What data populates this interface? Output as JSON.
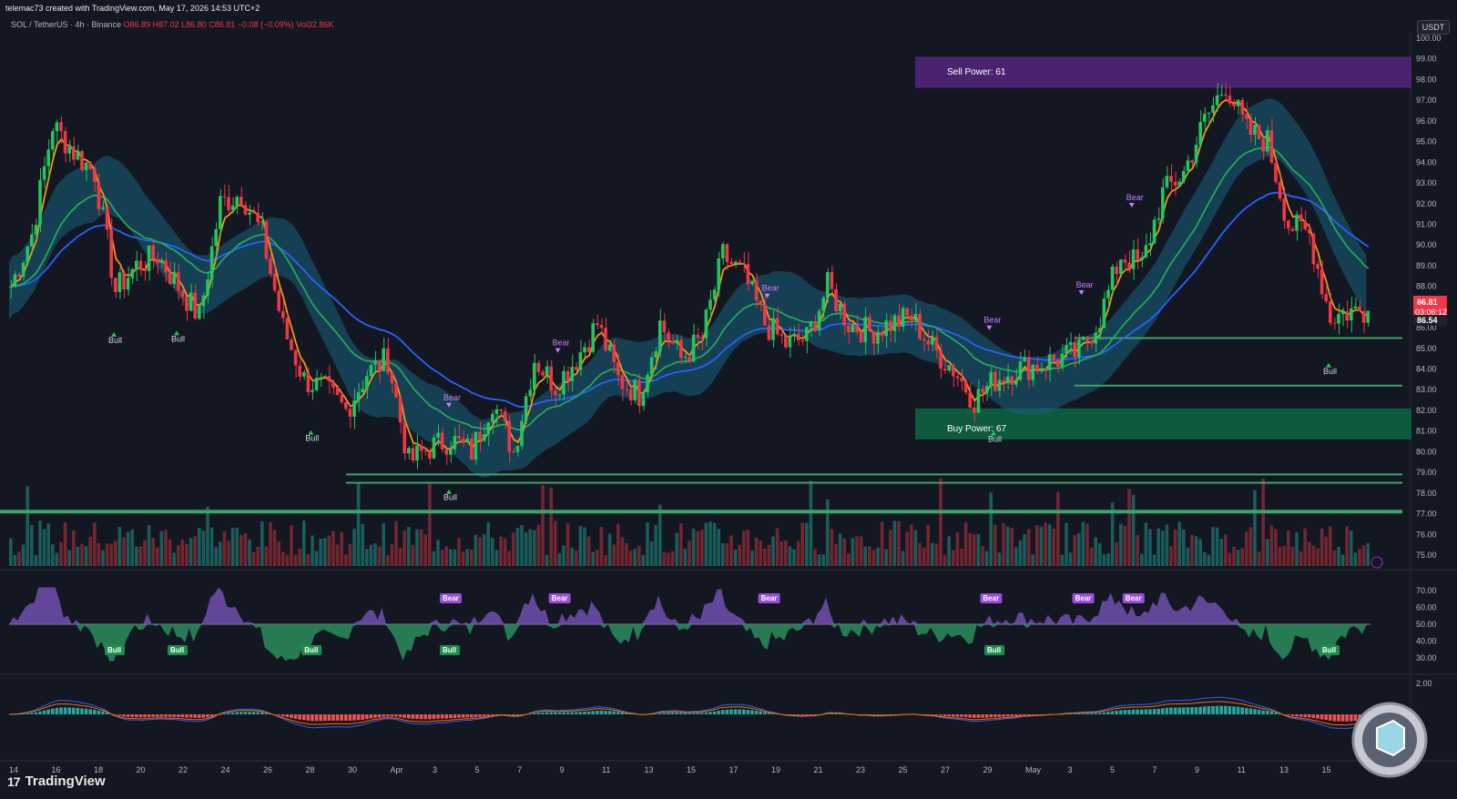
{
  "header": {
    "credit": "telemac73 created with TradingView.com, May 17, 2026 14:53 UTC+2",
    "symbol": "SOL / TetherUS · 4h · Binance",
    "open": "O86.89",
    "high": "H87.02",
    "low": "L86.80",
    "close": "C86.81",
    "change": "−0.08 (−0.09%)",
    "volume": "Vol32.86K"
  },
  "currency": "USDT",
  "brand": "TradingView",
  "colors": {
    "background": "#131722",
    "bull": "#22c55e",
    "bear": "#f23645",
    "ema_fast": "#f7931a",
    "ema_slow": "#2962ff",
    "ema_mid": "#26a65b",
    "sell_zone": "#4a2370",
    "buy_zone": "#0e5a3c",
    "cloud": "#17607a",
    "cloud_gray": "#4a4b55"
  },
  "zones": {
    "sell": "Sell Power: 61",
    "buy": "Buy Power: 67"
  },
  "price_labels": {
    "last": "86.81",
    "countdown": "03:06:12",
    "secondary": "86.54"
  },
  "price_axis": [
    "100.00",
    "99.00",
    "98.00",
    "97.00",
    "96.00",
    "95.00",
    "94.00",
    "93.00",
    "92.00",
    "91.00",
    "90.00",
    "89.00",
    "88.00",
    "87.00",
    "86.00",
    "85.00",
    "84.00",
    "83.00",
    "82.00",
    "81.00",
    "80.00",
    "79.00",
    "78.00",
    "77.00",
    "76.00",
    "75.00"
  ],
  "rsi_axis": [
    "70.00",
    "60.00",
    "50.00",
    "40.00",
    "30.00"
  ],
  "macd_axis": [
    "2.00"
  ],
  "time_axis": [
    "14",
    "16",
    "18",
    "20",
    "22",
    "24",
    "26",
    "28",
    "30",
    "Apr",
    "3",
    "5",
    "7",
    "9",
    "11",
    "13",
    "15",
    "17",
    "19",
    "21",
    "23",
    "25",
    "27",
    "29",
    "May",
    "3",
    "5",
    "7",
    "9",
    "11",
    "13",
    "15"
  ],
  "bull_label": "Bull",
  "bear_label": "Bear",
  "chart_data": {
    "type": "candlestick",
    "timeframe": "4h",
    "series_price": [
      {
        "date": "Mar 14",
        "close": 88.0
      },
      {
        "date": "Mar 15",
        "close": 90.5
      },
      {
        "date": "Mar 16",
        "close": 95.8
      },
      {
        "date": "Mar 17",
        "close": 94.5
      },
      {
        "date": "Mar 18",
        "close": 93.5
      },
      {
        "date": "Mar 19",
        "close": 87.8
      },
      {
        "date": "Mar 20",
        "close": 89.0
      },
      {
        "date": "Mar 21",
        "close": 89.5
      },
      {
        "date": "Mar 22",
        "close": 88.0
      },
      {
        "date": "Mar 23",
        "close": 86.5
      },
      {
        "date": "Mar 24",
        "close": 92.0
      },
      {
        "date": "Mar 25",
        "close": 92.5
      },
      {
        "date": "Mar 26",
        "close": 90.5
      },
      {
        "date": "Mar 27",
        "close": 86.0
      },
      {
        "date": "Mar 28",
        "close": 83.5
      },
      {
        "date": "Mar 29",
        "close": 83.0
      },
      {
        "date": "Mar 30",
        "close": 82.0
      },
      {
        "date": "Mar 31",
        "close": 83.8
      },
      {
        "date": "Apr 1",
        "close": 84.5
      },
      {
        "date": "Apr 2",
        "close": 79.5
      },
      {
        "date": "Apr 3",
        "close": 80.2
      },
      {
        "date": "Apr 4",
        "close": 80.6
      },
      {
        "date": "Apr 5",
        "close": 80.0
      },
      {
        "date": "Apr 6",
        "close": 82.5
      },
      {
        "date": "Apr 7",
        "close": 80.0
      },
      {
        "date": "Apr 8",
        "close": 84.5
      },
      {
        "date": "Apr 9",
        "close": 83.2
      },
      {
        "date": "Apr 10",
        "close": 84.5
      },
      {
        "date": "Apr 11",
        "close": 86.2
      },
      {
        "date": "Apr 12",
        "close": 83.5
      },
      {
        "date": "Apr 13",
        "close": 82.8
      },
      {
        "date": "Apr 14",
        "close": 86.2
      },
      {
        "date": "Apr 15",
        "close": 84.5
      },
      {
        "date": "Apr 16",
        "close": 85.5
      },
      {
        "date": "Apr 17",
        "close": 89.5
      },
      {
        "date": "Apr 18",
        "close": 88.5
      },
      {
        "date": "Apr 19",
        "close": 86.2
      },
      {
        "date": "Apr 20",
        "close": 85.2
      },
      {
        "date": "Apr 21",
        "close": 85.5
      },
      {
        "date": "Apr 22",
        "close": 88.0
      },
      {
        "date": "Apr 23",
        "close": 86.2
      },
      {
        "date": "Apr 24",
        "close": 85.8
      },
      {
        "date": "Apr 25",
        "close": 86.2
      },
      {
        "date": "Apr 26",
        "close": 86.5
      },
      {
        "date": "Apr 27",
        "close": 85.0
      },
      {
        "date": "Apr 28",
        "close": 84.0
      },
      {
        "date": "Apr 29",
        "close": 82.5
      },
      {
        "date": "Apr 30",
        "close": 83.5
      },
      {
        "date": "May 1",
        "close": 84.0
      },
      {
        "date": "May 2",
        "close": 84.2
      },
      {
        "date": "May 3",
        "close": 84.5
      },
      {
        "date": "May 4",
        "close": 84.8
      },
      {
        "date": "May 5",
        "close": 86.5
      },
      {
        "date": "May 6",
        "close": 89.5
      },
      {
        "date": "May 7",
        "close": 89.0
      },
      {
        "date": "May 8",
        "close": 92.5
      },
      {
        "date": "May 9",
        "close": 93.5
      },
      {
        "date": "May 10",
        "close": 96.0
      },
      {
        "date": "May 11",
        "close": 97.8
      },
      {
        "date": "May 12",
        "close": 95.5
      },
      {
        "date": "May 13",
        "close": 95.0
      },
      {
        "date": "May 14",
        "close": 91.0
      },
      {
        "date": "May 15",
        "close": 90.5
      },
      {
        "date": "May 16",
        "close": 86.5
      },
      {
        "date": "May 17",
        "close": 86.81
      }
    ],
    "ylim": [
      75,
      100
    ],
    "sell_zone": [
      97.6,
      99.1
    ],
    "buy_zone": [
      80.6,
      82.1
    ],
    "support_lines": [
      78.9,
      78.5,
      83.2,
      85.5
    ],
    "horizontal_line": 77.1,
    "rsi_ylim": [
      25,
      75
    ],
    "rsi_midline": 50
  }
}
